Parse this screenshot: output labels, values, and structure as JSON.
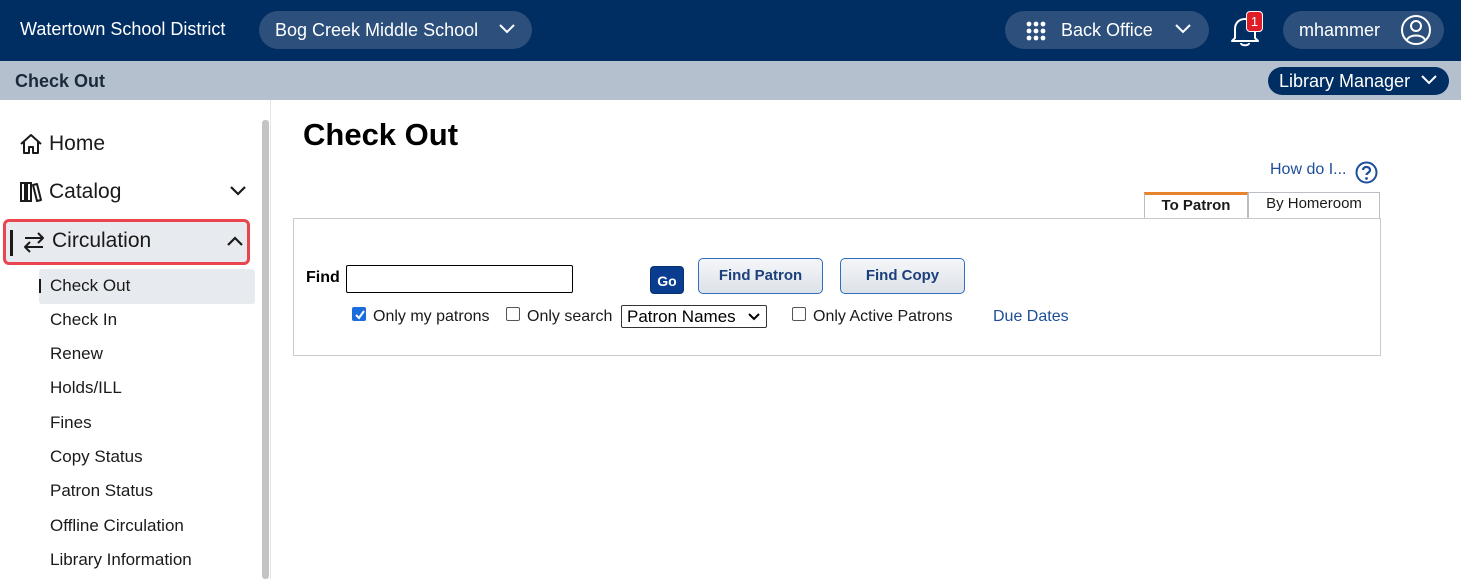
{
  "topbar": {
    "district": "Watertown School District",
    "school": "Bog Creek Middle School",
    "back_office": "Back Office",
    "notification_count": "1",
    "username": "mhammer"
  },
  "subbar": {
    "title": "Check Out",
    "role": "Library Manager"
  },
  "sidebar": {
    "home": "Home",
    "catalog": "Catalog",
    "circulation": "Circulation",
    "sub_items": [
      "Check Out",
      "Check In",
      "Renew",
      "Holds/ILL",
      "Fines",
      "Copy Status",
      "Patron Status",
      "Offline Circulation",
      "Library Information"
    ]
  },
  "main": {
    "title": "Check Out",
    "how_do_i": "How do I...",
    "tabs": [
      "To Patron",
      "By Homeroom"
    ],
    "find_label": "Find",
    "find_value": "",
    "go": "Go",
    "find_patron": "Find Patron",
    "find_copy": "Find Copy",
    "only_my_patrons": "Only my patrons",
    "only_search": "Only search",
    "search_select": "Patron Names",
    "only_active": "Only Active Patrons",
    "due_dates": "Due Dates"
  },
  "colors": {
    "topbar_bg": "#002d62",
    "subbar_bg": "#b4c0ce",
    "highlight_border": "#e8454f",
    "active_tab_accent": "#e8842d",
    "link": "#1c4e9a"
  }
}
